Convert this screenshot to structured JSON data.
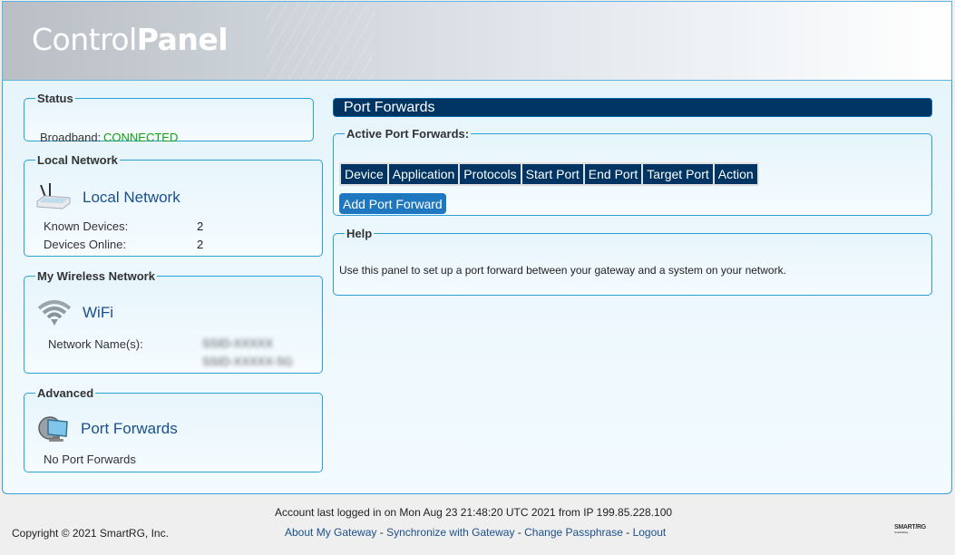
{
  "header": {
    "logo_light": "Control",
    "logo_bold": "Panel"
  },
  "sidebar": {
    "status": {
      "legend": "Status",
      "broadband_label": "Broadband:",
      "broadband_value": "CONNECTED",
      "broadband_color": "#12a012"
    },
    "local_network": {
      "legend": "Local Network",
      "icon": "router-icon",
      "title": "Local Network",
      "known_devices_label": "Known Devices:",
      "known_devices_value": "2",
      "devices_online_label": "Devices Online:",
      "devices_online_value": "2"
    },
    "wireless": {
      "legend": "My Wireless Network",
      "icon": "wifi-icon",
      "title": "WiFi",
      "network_names_label": "Network Name(s):",
      "network_names": [
        "SSID-XXXXX",
        "SSID-XXXXX-5G"
      ]
    },
    "advanced": {
      "legend": "Advanced",
      "icon": "computer-network-icon",
      "title": "Port Forwards",
      "status_text": "No Port Forwards"
    }
  },
  "main": {
    "title": "Port Forwards",
    "active": {
      "legend": "Active Port Forwards:",
      "columns": [
        "Device",
        "Application",
        "Protocols",
        "Start Port",
        "End Port",
        "Target Port",
        "Action"
      ],
      "rows": [],
      "add_button": "Add Port Forward"
    },
    "help": {
      "legend": "Help",
      "text": "Use this panel to set up a port forward between your gateway and a system on your network."
    }
  },
  "footer": {
    "copyright": "Copyright © 2021 SmartRG, Inc.",
    "last_login": "Account last logged in on Mon Aug 23 21:48:20 UTC 2021 from IP 199.85.228.100",
    "links": [
      "About My Gateway",
      "Synchronize with Gateway",
      "Change Passphrase",
      "Logout"
    ],
    "separator": " - ",
    "brand": "SMART/RG",
    "brand_tagline": "Smart thinking"
  },
  "colors": {
    "accent": "#003462",
    "border": "#2aa0d4",
    "link": "#1b4f8c",
    "button": "#1f77c0"
  }
}
